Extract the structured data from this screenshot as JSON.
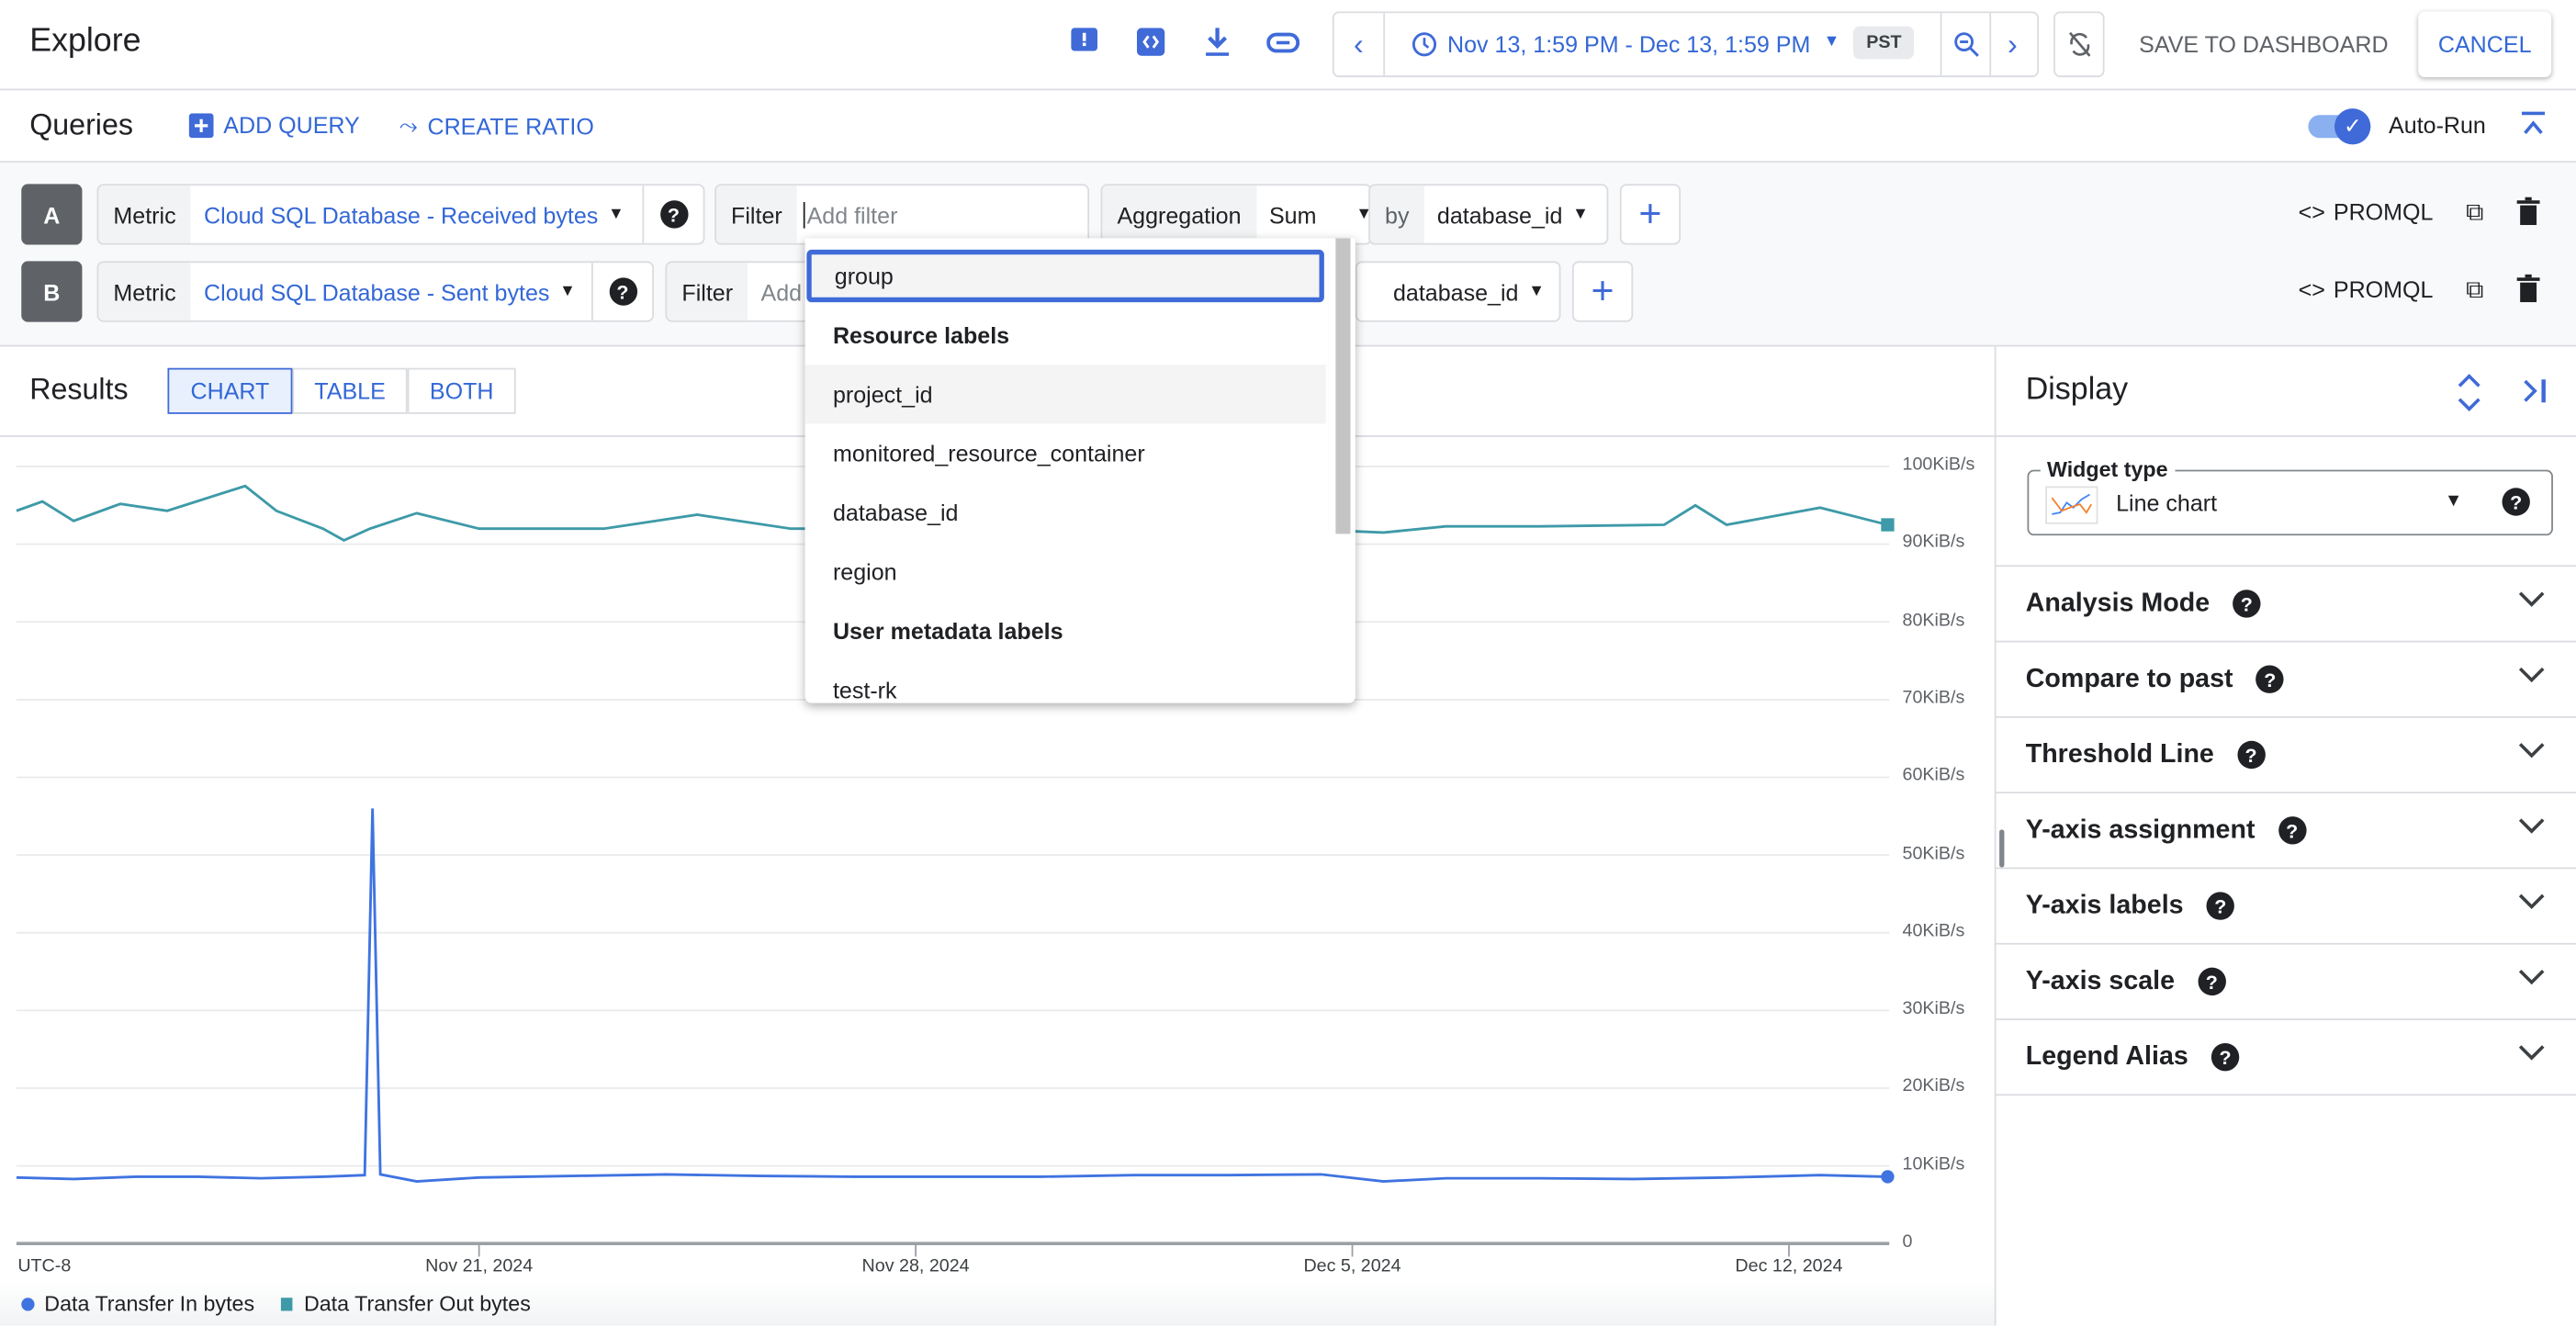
{
  "header": {
    "title": "Explore",
    "time_range": "Nov 13, 1:59 PM - Dec 13, 1:59 PM",
    "timezone": "PST",
    "save_label": "SAVE TO DASHBOARD",
    "cancel_label": "CANCEL"
  },
  "queries": {
    "title": "Queries",
    "add_query": "ADD QUERY",
    "create_ratio": "CREATE RATIO",
    "auto_run": "Auto-Run",
    "auto_run_on": true,
    "rows": [
      {
        "letter": "A",
        "metric_label": "Metric",
        "metric": "Cloud SQL Database - Received bytes",
        "filter_label": "Filter",
        "filter_placeholder": "Add filter",
        "aggregation_label": "Aggregation",
        "aggregation": "Sum",
        "by_label": "by",
        "group_by": "database_id",
        "promql": "PROMQL"
      },
      {
        "letter": "B",
        "metric_label": "Metric",
        "metric": "Cloud SQL Database - Sent bytes",
        "filter_label": "Filter",
        "filter_placeholder": "Add",
        "group_by": "database_id",
        "promql": "PROMQL"
      }
    ]
  },
  "dropdown": {
    "items": [
      {
        "label": "group",
        "type": "item",
        "state": "focused"
      },
      {
        "label": "Resource labels",
        "type": "header"
      },
      {
        "label": "project_id",
        "type": "item",
        "state": "hover"
      },
      {
        "label": "monitored_resource_container",
        "type": "item"
      },
      {
        "label": "database_id",
        "type": "item"
      },
      {
        "label": "region",
        "type": "item"
      },
      {
        "label": "User metadata labels",
        "type": "header"
      },
      {
        "label": "test-rk",
        "type": "item"
      }
    ]
  },
  "results": {
    "title": "Results",
    "tabs": [
      "CHART",
      "TABLE",
      "BOTH"
    ],
    "active_tab": "CHART"
  },
  "chart_data": {
    "type": "line",
    "xlabel": "",
    "ylabel": "",
    "timezone_label": "UTC-8",
    "x_ticks": [
      "Nov 21, 2024",
      "Nov 28, 2024",
      "Dec 5, 2024",
      "Dec 12, 2024"
    ],
    "y_ticks": [
      "0",
      "10KiB/s",
      "20KiB/s",
      "30KiB/s",
      "40KiB/s",
      "50KiB/s",
      "60KiB/s",
      "70KiB/s",
      "80KiB/s",
      "90KiB/s",
      "100KiB/s"
    ],
    "ylim": [
      0,
      100
    ],
    "xlim": [
      "2024-11-13T13:59",
      "2024-12-13T13:59"
    ],
    "grid": true,
    "legend": "bottom-left",
    "series": [
      {
        "name": "Data Transfer In bytes",
        "color": "#3f73e0",
        "points": [
          [
            "2024-11-13T14:00",
            8.5
          ],
          [
            "2024-11-14T12:00",
            8.3
          ],
          [
            "2024-11-15T12:00",
            8.6
          ],
          [
            "2024-11-16T12:00",
            8.6
          ],
          [
            "2024-11-17T12:00",
            8.4
          ],
          [
            "2024-11-18T12:00",
            8.6
          ],
          [
            "2024-11-19T04:00",
            8.8
          ],
          [
            "2024-11-19T07:00",
            56
          ],
          [
            "2024-11-19T10:00",
            8.9
          ],
          [
            "2024-11-20T00:00",
            8.0
          ],
          [
            "2024-11-21T00:00",
            8.5
          ],
          [
            "2024-11-22T12:00",
            8.7
          ],
          [
            "2024-11-24T00:00",
            8.9
          ],
          [
            "2024-11-25T12:00",
            8.7
          ],
          [
            "2024-11-27T00:00",
            8.6
          ],
          [
            "2024-11-28T12:00",
            8.6
          ],
          [
            "2024-11-30T00:00",
            8.6
          ],
          [
            "2024-12-01T12:00",
            8.8
          ],
          [
            "2024-12-03T00:00",
            8.8
          ],
          [
            "2024-12-04T12:00",
            8.9
          ],
          [
            "2024-12-05T12:00",
            8.0
          ],
          [
            "2024-12-06T12:00",
            8.4
          ],
          [
            "2024-12-08T00:00",
            8.4
          ],
          [
            "2024-12-09T12:00",
            8.3
          ],
          [
            "2024-12-11T00:00",
            8.5
          ],
          [
            "2024-12-12T12:00",
            8.8
          ],
          [
            "2024-12-13T13:59",
            8.6
          ]
        ]
      },
      {
        "name": "Data Transfer Out bytes",
        "color": "#3e9aa8",
        "points": [
          [
            "2024-11-13T14:00",
            94.3
          ],
          [
            "2024-11-14T00:00",
            95.5
          ],
          [
            "2024-11-14T12:00",
            93.0
          ],
          [
            "2024-11-15T06:00",
            95.2
          ],
          [
            "2024-11-16T00:00",
            94.3
          ],
          [
            "2024-11-17T06:00",
            97.5
          ],
          [
            "2024-11-17T18:00",
            94.3
          ],
          [
            "2024-11-18T12:00",
            92.0
          ],
          [
            "2024-11-18T20:00",
            90.5
          ],
          [
            "2024-11-19T06:00",
            92.0
          ],
          [
            "2024-11-20T00:00",
            94.0
          ],
          [
            "2024-11-21T00:00",
            92.0
          ],
          [
            "2024-11-23T00:00",
            92.0
          ],
          [
            "2024-11-24T12:00",
            93.8
          ],
          [
            "2024-11-26T00:00",
            92.0
          ],
          [
            "2024-11-28T00:00",
            92.0
          ],
          [
            "2024-11-30T00:00",
            92.0
          ],
          [
            "2024-12-02T00:00",
            92.0
          ],
          [
            "2024-12-04T00:00",
            92.0
          ],
          [
            "2024-12-05T12:00",
            91.5
          ],
          [
            "2024-12-06T12:00",
            92.3
          ],
          [
            "2024-12-08T00:00",
            92.3
          ],
          [
            "2024-12-10T00:00",
            92.5
          ],
          [
            "2024-12-10T12:00",
            95.0
          ],
          [
            "2024-12-11T00:00",
            92.5
          ],
          [
            "2024-12-12T12:00",
            94.7
          ],
          [
            "2024-12-13T13:59",
            92.5
          ]
        ]
      }
    ]
  },
  "display": {
    "title": "Display",
    "widget_type_label": "Widget type",
    "widget_type": "Line chart",
    "sections": [
      "Analysis Mode",
      "Compare to past",
      "Threshold Line",
      "Y-axis assignment",
      "Y-axis labels",
      "Y-axis scale",
      "Legend Alias"
    ]
  }
}
